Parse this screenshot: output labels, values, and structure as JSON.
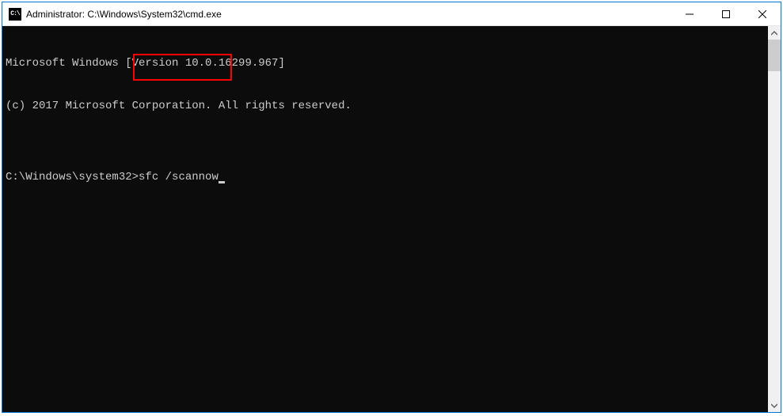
{
  "window": {
    "title": "Administrator: C:\\Windows\\System32\\cmd.exe",
    "icon_label": "C:\\"
  },
  "terminal": {
    "line1": "Microsoft Windows [Version 10.0.16299.967]",
    "line2": "(c) 2017 Microsoft Corporation. All rights reserved.",
    "blank": "",
    "prompt": "C:\\Windows\\system32>",
    "command": "sfc /scannow"
  },
  "controls": {
    "minimize": "Minimize",
    "maximize": "Maximize",
    "close": "Close"
  }
}
